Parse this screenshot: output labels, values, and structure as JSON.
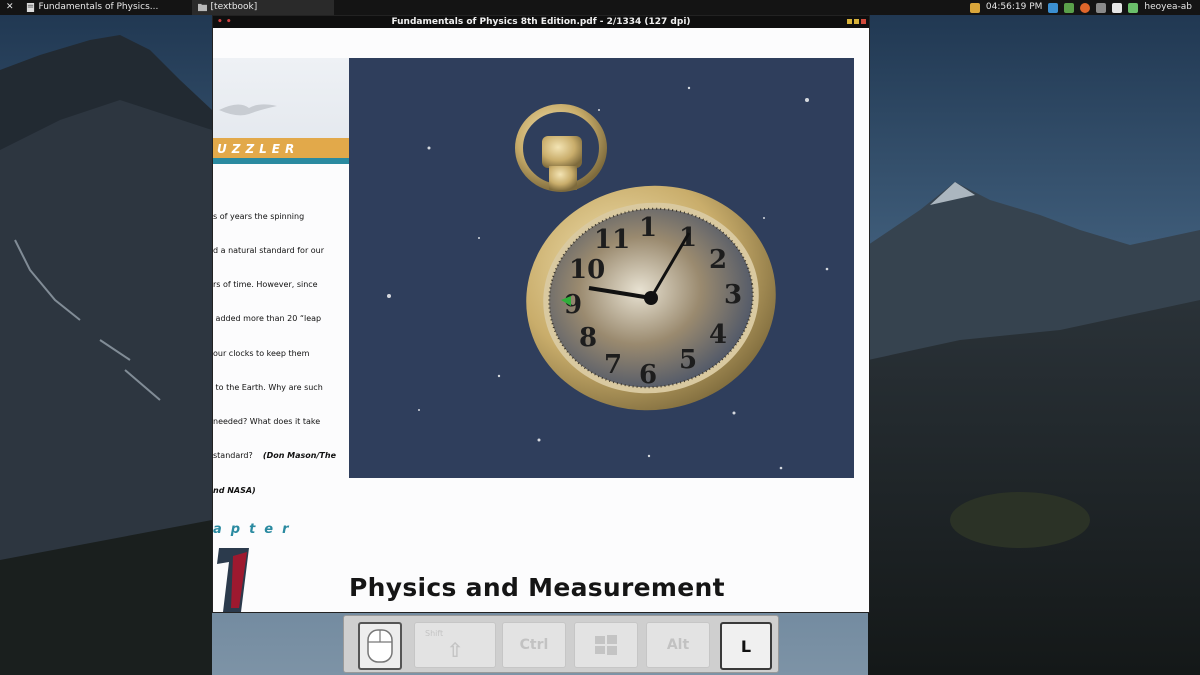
{
  "panel": {
    "tasks": [
      {
        "label": "Fundamentals of Physics..."
      },
      {
        "label": "[textbook]"
      }
    ],
    "clock": "04:56:19 PM",
    "user": "heoyea-ab"
  },
  "viewer": {
    "title": "Fundamentals of Physics 8th Edition.pdf - 2/1334 (127 dpi)",
    "menu_marker": "• •"
  },
  "page": {
    "banner": "UZZLER",
    "caption_lines": [
      "s of years the spinning",
      "d a natural standard for our",
      "rs of time. However, since",
      " added more than 20 “leap",
      "our clocks to keep them",
      " to the Earth. Why are such",
      "needed? What does it take",
      "standard?"
    ],
    "caption_credit_1": "(Don Mason/The",
    "caption_credit_2": "nd NASA)",
    "chapter_word": "apter",
    "heading": "Physics and Measurement"
  },
  "keys": {
    "shift": "Shift",
    "ctrl": "Ctrl",
    "alt": "Alt",
    "pressed": "L"
  },
  "colors": {
    "photo_bg": "#2f3e5c",
    "banner_gold": "#e2a94a",
    "banner_teal": "#2a8aa0",
    "chapter_accent": "#2a8aa0"
  }
}
